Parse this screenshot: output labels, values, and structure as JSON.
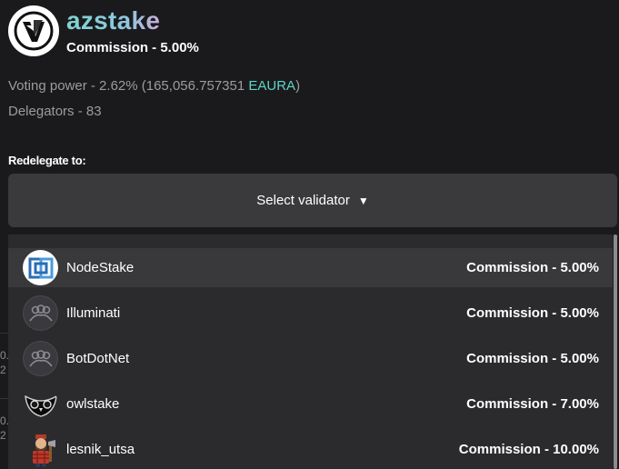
{
  "validator": {
    "name": "azstake",
    "commission": "Commission - 5.00%",
    "voting_power_text": "Voting power - 2.62%  (165,056.757351 ",
    "voting_power_denom": "EAURA",
    "voting_power_close": ")",
    "delegators": "Delegators - 83"
  },
  "redelegate": {
    "label": "Redelegate to:",
    "select_placeholder": "Select validator",
    "arrow": "▼"
  },
  "background_fragments": {
    "first": "0.",
    "second": "2",
    "third": "0.",
    "fourth": "2"
  },
  "validators_list": [
    {
      "name": "NodeStake",
      "commission": "Commission - 5.00%",
      "icon": "nodestake-logo-icon"
    },
    {
      "name": "Illuminati",
      "commission": "Commission - 5.00%",
      "icon": "group-icon"
    },
    {
      "name": "BotDotNet",
      "commission": "Commission - 5.00%",
      "icon": "group-icon"
    },
    {
      "name": "owlstake",
      "commission": "Commission - 7.00%",
      "icon": "owl-logo-icon"
    },
    {
      "name": "lesnik_utsa",
      "commission": "Commission - 10.00%",
      "icon": "lumberjack-avatar-icon"
    }
  ],
  "colors": {
    "background": "#1a1a1c",
    "accent": "#5fd3c6",
    "select_bg": "#3a3a3d",
    "dropdown_bg": "#2b2b2e",
    "active_row_bg": "#39393c"
  }
}
